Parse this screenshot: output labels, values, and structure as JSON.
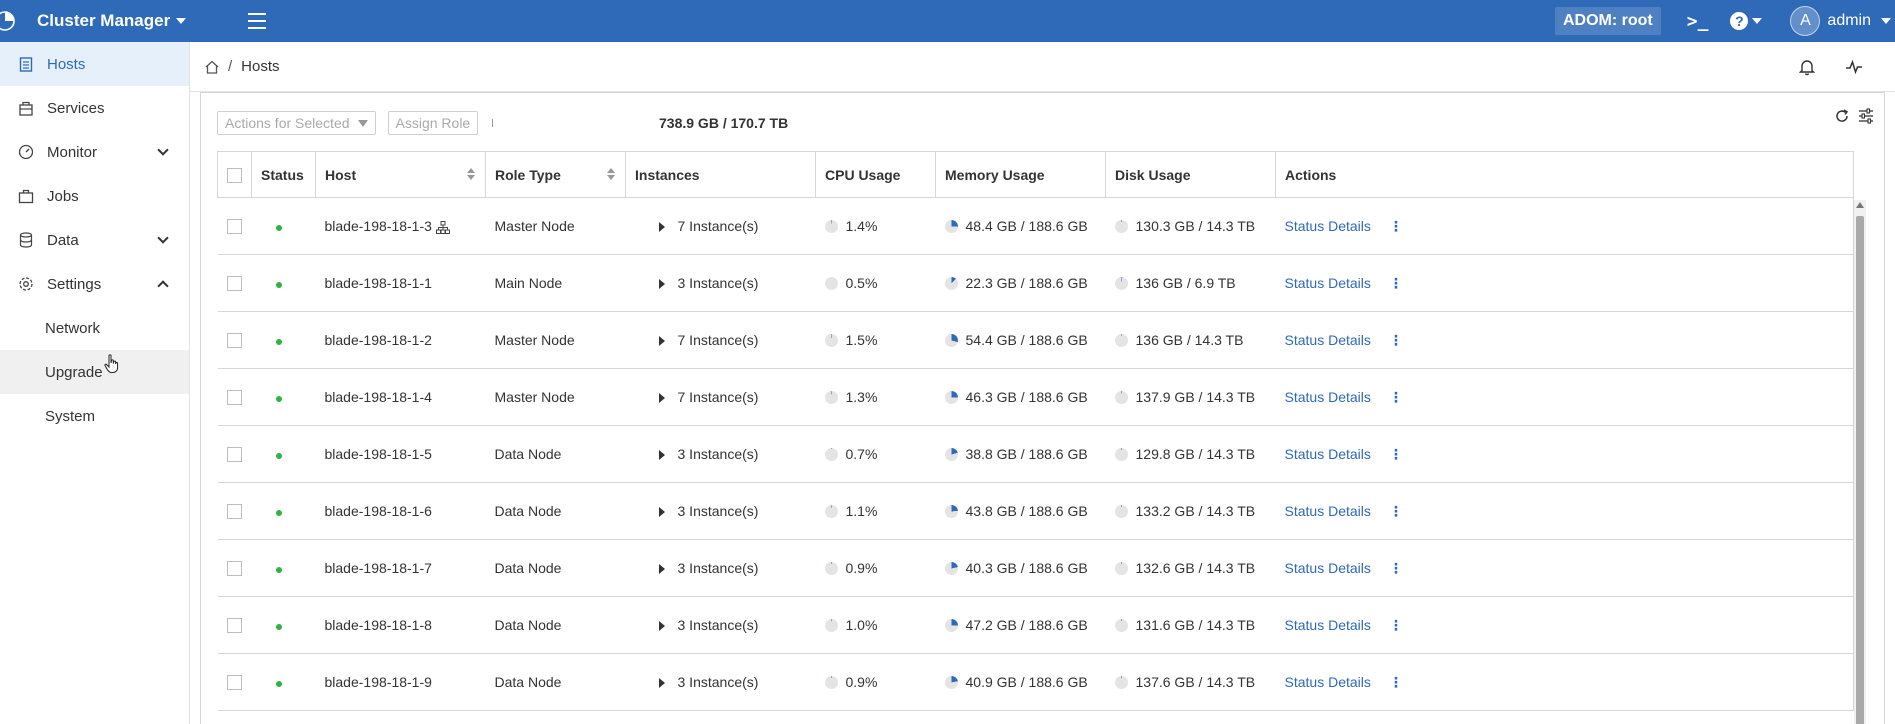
{
  "topbar": {
    "app_title": "Cluster Manager",
    "adom": "ADOM: root",
    "terminal_glyph": ">_",
    "help_glyph": "?",
    "avatar_initial": "A",
    "user": "admin"
  },
  "sidebar": {
    "items": [
      {
        "label": "Hosts",
        "icon": "hosts-icon"
      },
      {
        "label": "Services",
        "icon": "services-icon"
      },
      {
        "label": "Monitor",
        "icon": "monitor-icon"
      },
      {
        "label": "Jobs",
        "icon": "jobs-icon"
      },
      {
        "label": "Data",
        "icon": "data-icon"
      },
      {
        "label": "Settings",
        "icon": "settings-icon"
      },
      {
        "label": "Network"
      },
      {
        "label": "Upgrade"
      },
      {
        "label": "System"
      }
    ]
  },
  "breadcrumb": {
    "separator": "/",
    "page": "Hosts"
  },
  "toolbar": {
    "actions_label": "Actions for Selected",
    "assign_role_label": "Assign Role",
    "capacity": "738.9 GB / 170.7 TB"
  },
  "table": {
    "headers": {
      "status": "Status",
      "host": "Host",
      "role_type": "Role Type",
      "instances": "Instances",
      "cpu": "CPU Usage",
      "memory": "Memory Usage",
      "disk": "Disk Usage",
      "actions": "Actions"
    },
    "rows": [
      {
        "host": "blade-198-18-1-3",
        "role": "Master Node",
        "instances": "7 Instance(s)",
        "cpu": "1.4%",
        "memory": "48.4 GB / 188.6 GB",
        "disk": "130.3 GB / 14.3 TB",
        "action": "Status Details",
        "more": "⋮"
      },
      {
        "host": "blade-198-18-1-1",
        "role": "Main Node",
        "instances": "3 Instance(s)",
        "cpu": "0.5%",
        "memory": "22.3 GB / 188.6 GB",
        "disk": "136 GB / 6.9 TB",
        "action": "Status Details",
        "more": "⋮"
      },
      {
        "host": "blade-198-18-1-2",
        "role": "Master Node",
        "instances": "7 Instance(s)",
        "cpu": "1.5%",
        "memory": "54.4 GB / 188.6 GB",
        "disk": "136 GB / 14.3 TB",
        "action": "Status Details",
        "more": "⋮"
      },
      {
        "host": "blade-198-18-1-4",
        "role": "Master Node",
        "instances": "7 Instance(s)",
        "cpu": "1.3%",
        "memory": "46.3 GB / 188.6 GB",
        "disk": "137.9 GB / 14.3 TB",
        "action": "Status Details",
        "more": "⋮"
      },
      {
        "host": "blade-198-18-1-5",
        "role": "Data Node",
        "instances": "3 Instance(s)",
        "cpu": "0.7%",
        "memory": "38.8 GB / 188.6 GB",
        "disk": "129.8 GB / 14.3 TB",
        "action": "Status Details",
        "more": "⋮"
      },
      {
        "host": "blade-198-18-1-6",
        "role": "Data Node",
        "instances": "3 Instance(s)",
        "cpu": "1.1%",
        "memory": "43.8 GB / 188.6 GB",
        "disk": "133.2 GB / 14.3 TB",
        "action": "Status Details",
        "more": "⋮"
      },
      {
        "host": "blade-198-18-1-7",
        "role": "Data Node",
        "instances": "3 Instance(s)",
        "cpu": "0.9%",
        "memory": "40.3 GB / 188.6 GB",
        "disk": "132.6 GB / 14.3 TB",
        "action": "Status Details",
        "more": "⋮"
      },
      {
        "host": "blade-198-18-1-8",
        "role": "Data Node",
        "instances": "3 Instance(s)",
        "cpu": "1.0%",
        "memory": "47.2 GB / 188.6 GB",
        "disk": "131.6 GB / 14.3 TB",
        "action": "Status Details",
        "more": "⋮"
      },
      {
        "host": "blade-198-18-1-9",
        "role": "Data Node",
        "instances": "3 Instance(s)",
        "cpu": "0.9%",
        "memory": "40.9 GB / 188.6 GB",
        "disk": "137.6 GB / 14.3 TB",
        "action": "Status Details",
        "more": "⋮"
      }
    ]
  },
  "colors": {
    "brand": "#2f6ab8",
    "status_ok": "#2fb344",
    "pie_fill": "#2f6ab8",
    "pie_empty": "#e4e4e4"
  }
}
